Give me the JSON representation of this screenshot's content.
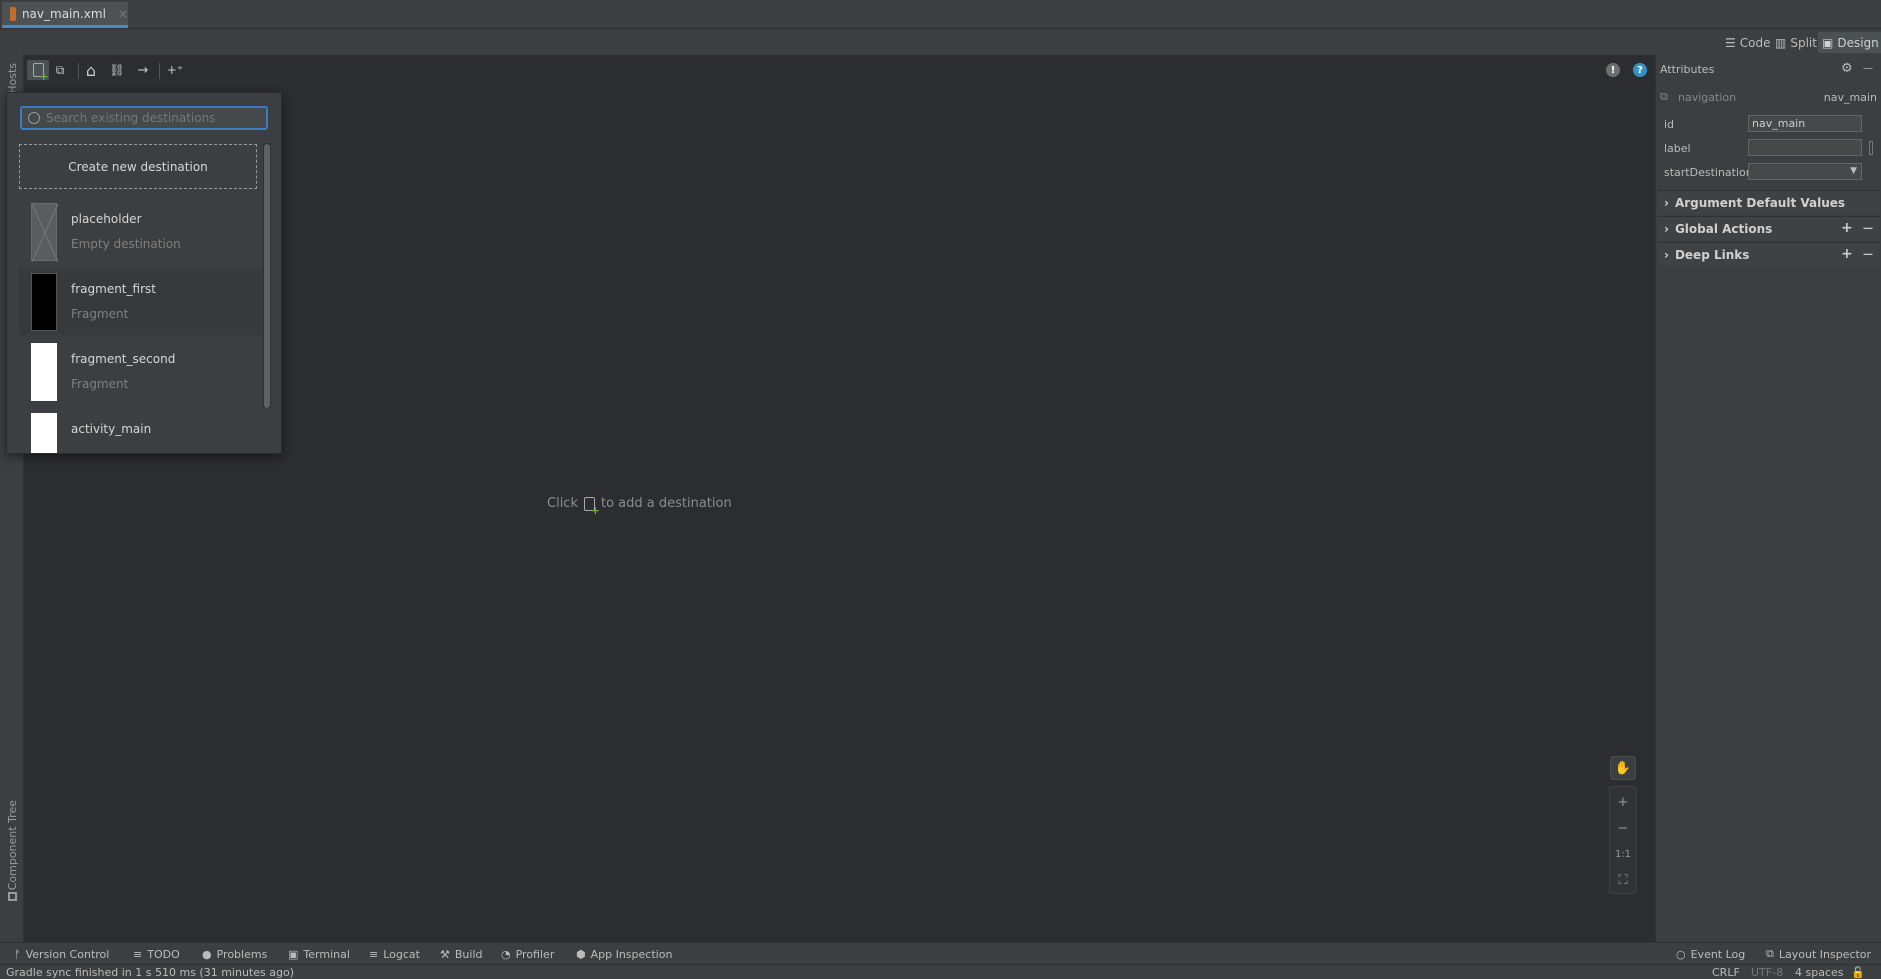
{
  "editor": {
    "tab_label": "nav_main.xml",
    "close_glyph": "×"
  },
  "view_modes": {
    "code": "Code",
    "split": "Split",
    "design": "Design"
  },
  "left_strip": {
    "hosts": "Hosts",
    "component_tree": "Component Tree"
  },
  "toolbar": {
    "new_destination_icon": "new-destination-icon",
    "nested_graph_icon": "nested-graph-icon",
    "home_glyph": "⌂",
    "link_glyph": "⛓",
    "arrow_glyph": "→",
    "auto_arrange_glyph": "+⁺",
    "info_glyph": "!",
    "help_glyph": "?"
  },
  "popup": {
    "search_placeholder": "Search existing destinations",
    "create_new": "Create new destination",
    "items": [
      {
        "name": "placeholder",
        "type": "Empty destination",
        "thumb": "placeholder"
      },
      {
        "name": "fragment_first",
        "type": "Fragment",
        "thumb": "dark"
      },
      {
        "name": "fragment_second",
        "type": "Fragment",
        "thumb": "light"
      },
      {
        "name": "activity_main",
        "type": "",
        "thumb": "light"
      }
    ]
  },
  "canvas": {
    "hint_prefix": "Click",
    "hint_suffix": "to add a destination"
  },
  "zoom": {
    "pan_glyph": "✋",
    "zoom_in_glyph": "+",
    "zoom_out_glyph": "−",
    "actual_size": "1:1",
    "fit_glyph": "⛶"
  },
  "attributes": {
    "title": "Attributes",
    "gear_glyph": "⚙",
    "minimize_glyph": "—",
    "navigation_label": "navigation",
    "navigation_value": "nav_main",
    "fields": [
      {
        "label": "id",
        "value": "nav_main"
      },
      {
        "label": "label",
        "value": ""
      },
      {
        "label": "startDestination",
        "value": ""
      }
    ],
    "sections": [
      {
        "label": "Argument Default Values",
        "has_controls": false
      },
      {
        "label": "Global Actions",
        "has_controls": true
      },
      {
        "label": "Deep Links",
        "has_controls": true
      }
    ],
    "chevron_glyph": "›",
    "plus_glyph": "+",
    "minus_glyph": "—"
  },
  "tool_windows": {
    "version_control": "Version Control",
    "todo": "TODO",
    "problems": "Problems",
    "terminal": "Terminal",
    "logcat": "Logcat",
    "build": "Build",
    "profiler": "Profiler",
    "app_inspection": "App Inspection",
    "event_log": "Event Log",
    "layout_inspector": "Layout Inspector"
  },
  "status": {
    "message": "Gradle sync finished in 1 s 510 ms (31 minutes ago)",
    "line_sep": "CRLF",
    "encoding": "UTF-8",
    "indent": "4 spaces"
  }
}
